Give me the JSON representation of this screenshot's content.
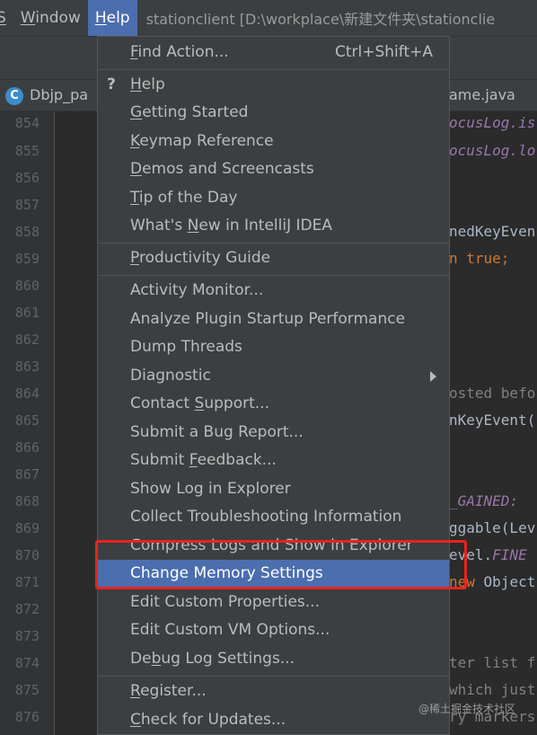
{
  "menubar": {
    "items": [
      {
        "label": "S",
        "mnemonic": "S",
        "rest": ""
      },
      {
        "label": "Window",
        "mnemonic": "W",
        "rest": "indow"
      },
      {
        "label": "Help",
        "mnemonic": "H",
        "rest": "elp"
      }
    ],
    "window_title": "stationclient [D:\\workplace\\新建文件夹\\stationclie"
  },
  "tabs": {
    "left": {
      "icon": "C",
      "label": "Dbjp_pa"
    },
    "right": {
      "label": "ame.java"
    }
  },
  "gutter": {
    "line_numbers": [
      "854",
      "855",
      "856",
      "857",
      "858",
      "859",
      "860",
      "861",
      "862",
      "863",
      "864",
      "865",
      "866",
      "867",
      "868",
      "869",
      "870",
      "871",
      "872",
      "873",
      "874",
      "875",
      "876"
    ]
  },
  "code_fragments": {
    "l854": "ocusLog.is",
    "l855": "ocusLog.lo",
    "l858": "nedKeyEven",
    "l859": "n true;",
    "l864": "osted befo",
    "l865": "nKeyEvent(",
    "l868": "_GAINED:",
    "l869": "ggable(Lev",
    "l870_a": "evel.",
    "l870_b": "FINE",
    "l871_a": "new",
    "l871_b": " Object",
    "l874": "ter list f",
    "l875": "which just",
    "l876": "ry markers"
  },
  "help_menu": {
    "find_action": {
      "pre": "",
      "mn": "F",
      "post": "ind Action...",
      "shortcut": "Ctrl+Shift+A"
    },
    "help": {
      "pre": "",
      "mn": "H",
      "post": "elp",
      "icon": "?"
    },
    "getting_started": {
      "pre": "",
      "mn": "G",
      "post": "etting Started"
    },
    "keymap_reference": {
      "pre": "",
      "mn": "K",
      "post": "eymap Reference"
    },
    "demos": {
      "pre": "",
      "mn": "D",
      "post": "emos and Screencasts"
    },
    "tip_of_day": {
      "pre": "",
      "mn": "T",
      "post": "ip of the Day"
    },
    "whats_new": {
      "pre": "What's ",
      "mn": "N",
      "post": "ew in IntelliJ IDEA"
    },
    "productivity": {
      "pre": "",
      "mn": "P",
      "post": "roductivity Guide"
    },
    "activity_monitor": "Activity Monitor...",
    "analyze_plugin": "Analyze Plugin Startup Performance",
    "dump_threads": "Dump Threads",
    "diagnostic": "Diagnostic",
    "contact_support": {
      "pre": "Contact ",
      "mn": "S",
      "post": "upport..."
    },
    "submit_bug": "Submit a Bug Report...",
    "submit_feedback": {
      "pre": "Submit ",
      "mn": "F",
      "post": "eedback..."
    },
    "show_log": "Show Log in Explorer",
    "collect_troubleshooting": "Collect Troubleshooting Information",
    "compress_logs": "Compress Logs and Show in Explorer",
    "change_memory": "Change Memory Settings",
    "edit_custom_props": "Edit Custom Properties...",
    "edit_custom_vm": "Edit Custom VM Options...",
    "debug_log": {
      "pre": "De",
      "mn": "b",
      "post": "ug Log Settings..."
    },
    "register": {
      "pre": "",
      "mn": "R",
      "post": "egister..."
    },
    "check_updates": {
      "pre": "",
      "mn": "C",
      "post": "heck for Updates..."
    }
  },
  "colors": {
    "selection": "#4b6eaf",
    "highlight_box": "#e8231b",
    "background": "#2b2b2b",
    "menu_background": "#3c3f41"
  },
  "watermark": "@稀土掘金技术社区"
}
